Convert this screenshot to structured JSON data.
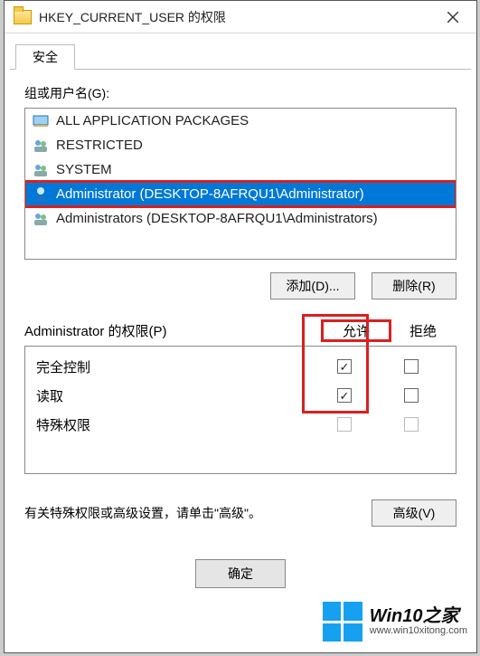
{
  "titlebar": {
    "title": "HKEY_CURRENT_USER 的权限"
  },
  "tab": {
    "label": "安全"
  },
  "groupsLabel": "组或用户名(G):",
  "principals": [
    {
      "name": "ALL APPLICATION PACKAGES",
      "type": "package"
    },
    {
      "name": "RESTRICTED",
      "type": "group"
    },
    {
      "name": "SYSTEM",
      "type": "group"
    },
    {
      "name": "Administrator (DESKTOP-8AFRQU1\\Administrator)",
      "type": "user",
      "selected": true
    },
    {
      "name": "Administrators (DESKTOP-8AFRQU1\\Administrators)",
      "type": "group"
    }
  ],
  "buttons": {
    "add": "添加(D)...",
    "remove": "删除(R)",
    "advanced": "高级(V)",
    "ok": "确定"
  },
  "permHeader": {
    "label": "Administrator 的权限(P)",
    "allow": "允许",
    "deny": "拒绝"
  },
  "permissions": [
    {
      "name": "完全控制",
      "allow": true,
      "deny": false,
      "disabled": false
    },
    {
      "name": "读取",
      "allow": true,
      "deny": false,
      "disabled": false
    },
    {
      "name": "特殊权限",
      "allow": false,
      "deny": false,
      "disabled": true
    }
  ],
  "advancedText": "有关特殊权限或高级设置，请单击\"高级\"。",
  "watermark": {
    "brand": "Win10之家",
    "url": "www.win10xitong.com"
  }
}
